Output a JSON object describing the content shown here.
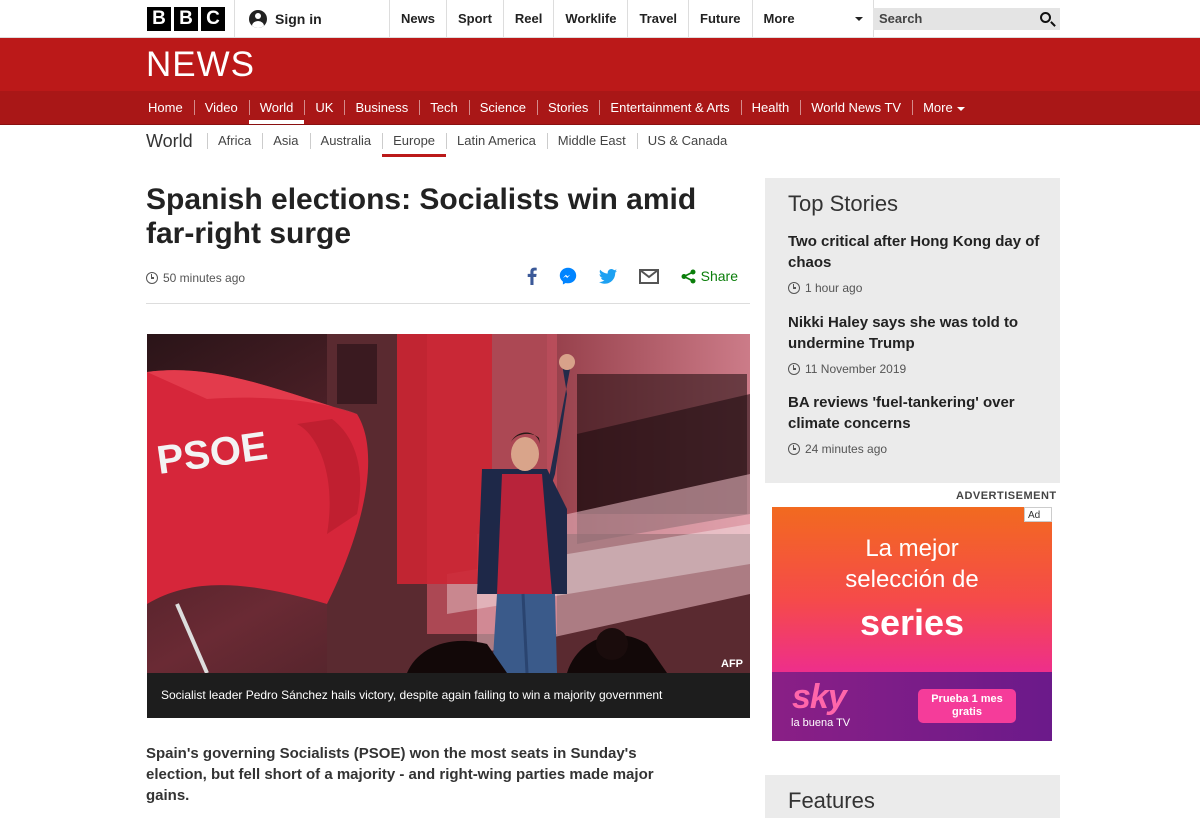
{
  "brand": {
    "logo_letters": [
      "B",
      "B",
      "C"
    ],
    "section_logo": "NEWS",
    "accent": "#bb1919"
  },
  "account": {
    "signin_label": "Sign in"
  },
  "top_nav": [
    "News",
    "Sport",
    "Reel",
    "Worklife",
    "Travel",
    "Future",
    "More"
  ],
  "search": {
    "label": "Search"
  },
  "main_nav": {
    "items": [
      "Home",
      "Video",
      "World",
      "UK",
      "Business",
      "Tech",
      "Science",
      "Stories",
      "Entertainment & Arts",
      "Health",
      "World News TV",
      "More"
    ],
    "active": "World"
  },
  "sub_nav": {
    "title": "World",
    "items": [
      "Africa",
      "Asia",
      "Australia",
      "Europe",
      "Latin America",
      "Middle East",
      "US & Canada"
    ],
    "active": "Europe"
  },
  "article": {
    "headline": "Spanish elections: Socialists win amid far-right surge",
    "timestamp": "50 minutes ago",
    "share_label": "Share",
    "share_icons": [
      "facebook-icon",
      "messenger-icon",
      "twitter-icon",
      "email-icon",
      "share-icon"
    ],
    "image_credit": "AFP",
    "image_flag_text": "PSOE",
    "caption": "Socialist leader Pedro Sánchez hails victory, despite again failing to win a majority government",
    "intro": "Spain's governing Socialists (PSOE) won the most seats in Sunday's election, but fell short of a majority - and right-wing parties made major gains."
  },
  "top_stories": {
    "title": "Top Stories",
    "items": [
      {
        "title": "Two critical after Hong Kong day of chaos",
        "time": "1 hour ago"
      },
      {
        "title": "Nikki Haley says she was told to undermine Trump",
        "time": "11 November 2019"
      },
      {
        "title": "BA reviews 'fuel-tankering' over climate concerns",
        "time": "24 minutes ago"
      }
    ]
  },
  "advert": {
    "label": "ADVERTISEMENT",
    "badge": "Ad",
    "line1": "La mejor",
    "line2": "selección de",
    "line3": "series",
    "brand": "sky",
    "tagline": "la buena TV",
    "cta": "Prueba 1 mes gratis"
  },
  "features": {
    "title": "Features"
  }
}
